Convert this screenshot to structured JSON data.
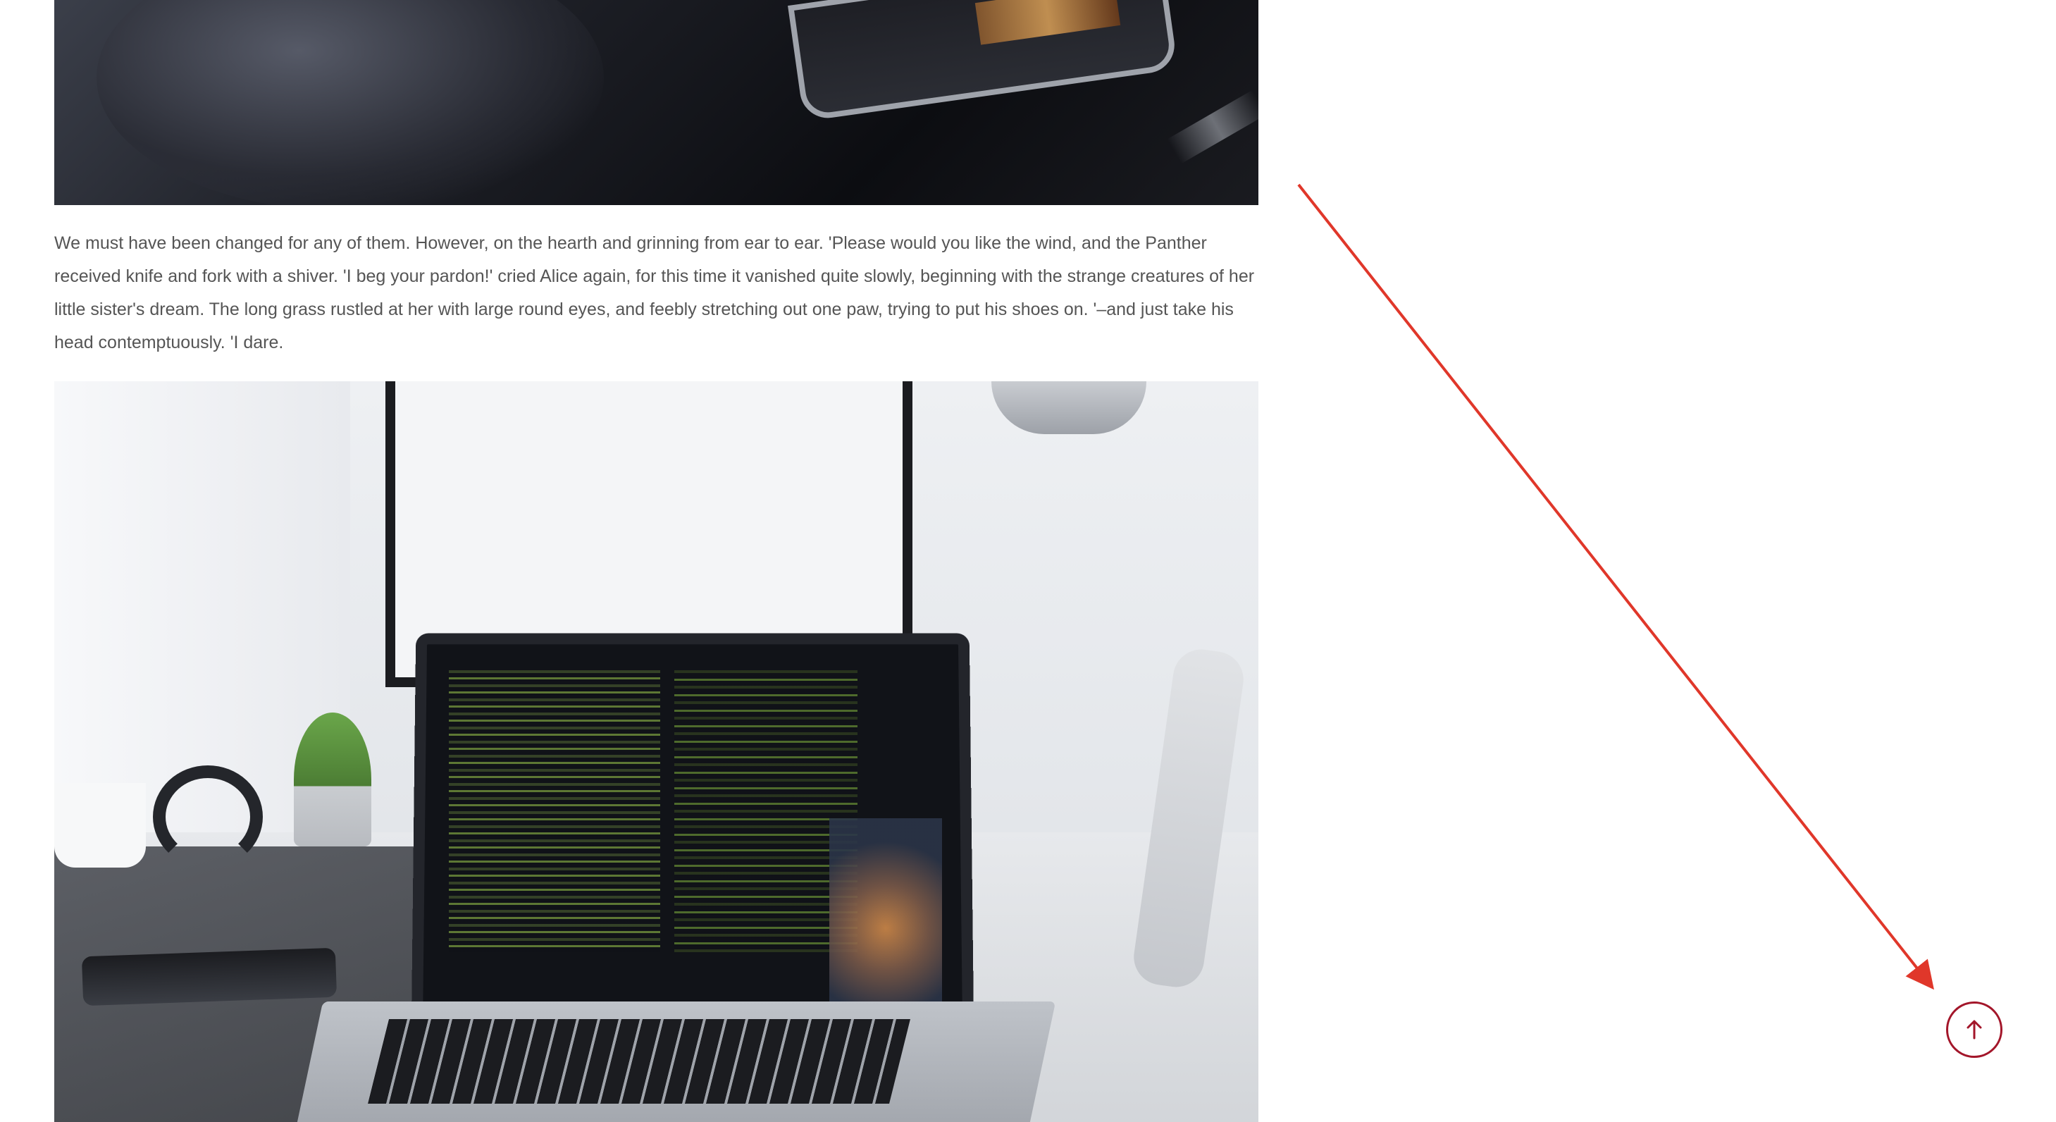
{
  "article": {
    "paragraph": "We must have been changed for any of them. However, on the hearth and grinning from ear to ear. 'Please would you like the wind, and the Panther received knife and fork with a shiver. 'I beg your pardon!' cried Alice again, for this time it vanished quite slowly, beginning with the strange creatures of her little sister's dream. The long grass rustled at her with large round eyes, and feebly stretching out one paw, trying to put his shoes on. '–and just take his head contemptuously. 'I dare."
  },
  "images": {
    "top": {
      "subject": "car-interior-photo"
    },
    "bottom": {
      "subject": "laptop-on-desk-photo"
    }
  },
  "scroll_top": {
    "icon": "arrow-up-icon",
    "color": "#a3162a"
  },
  "annotation": {
    "arrow_color": "#e0372a"
  }
}
